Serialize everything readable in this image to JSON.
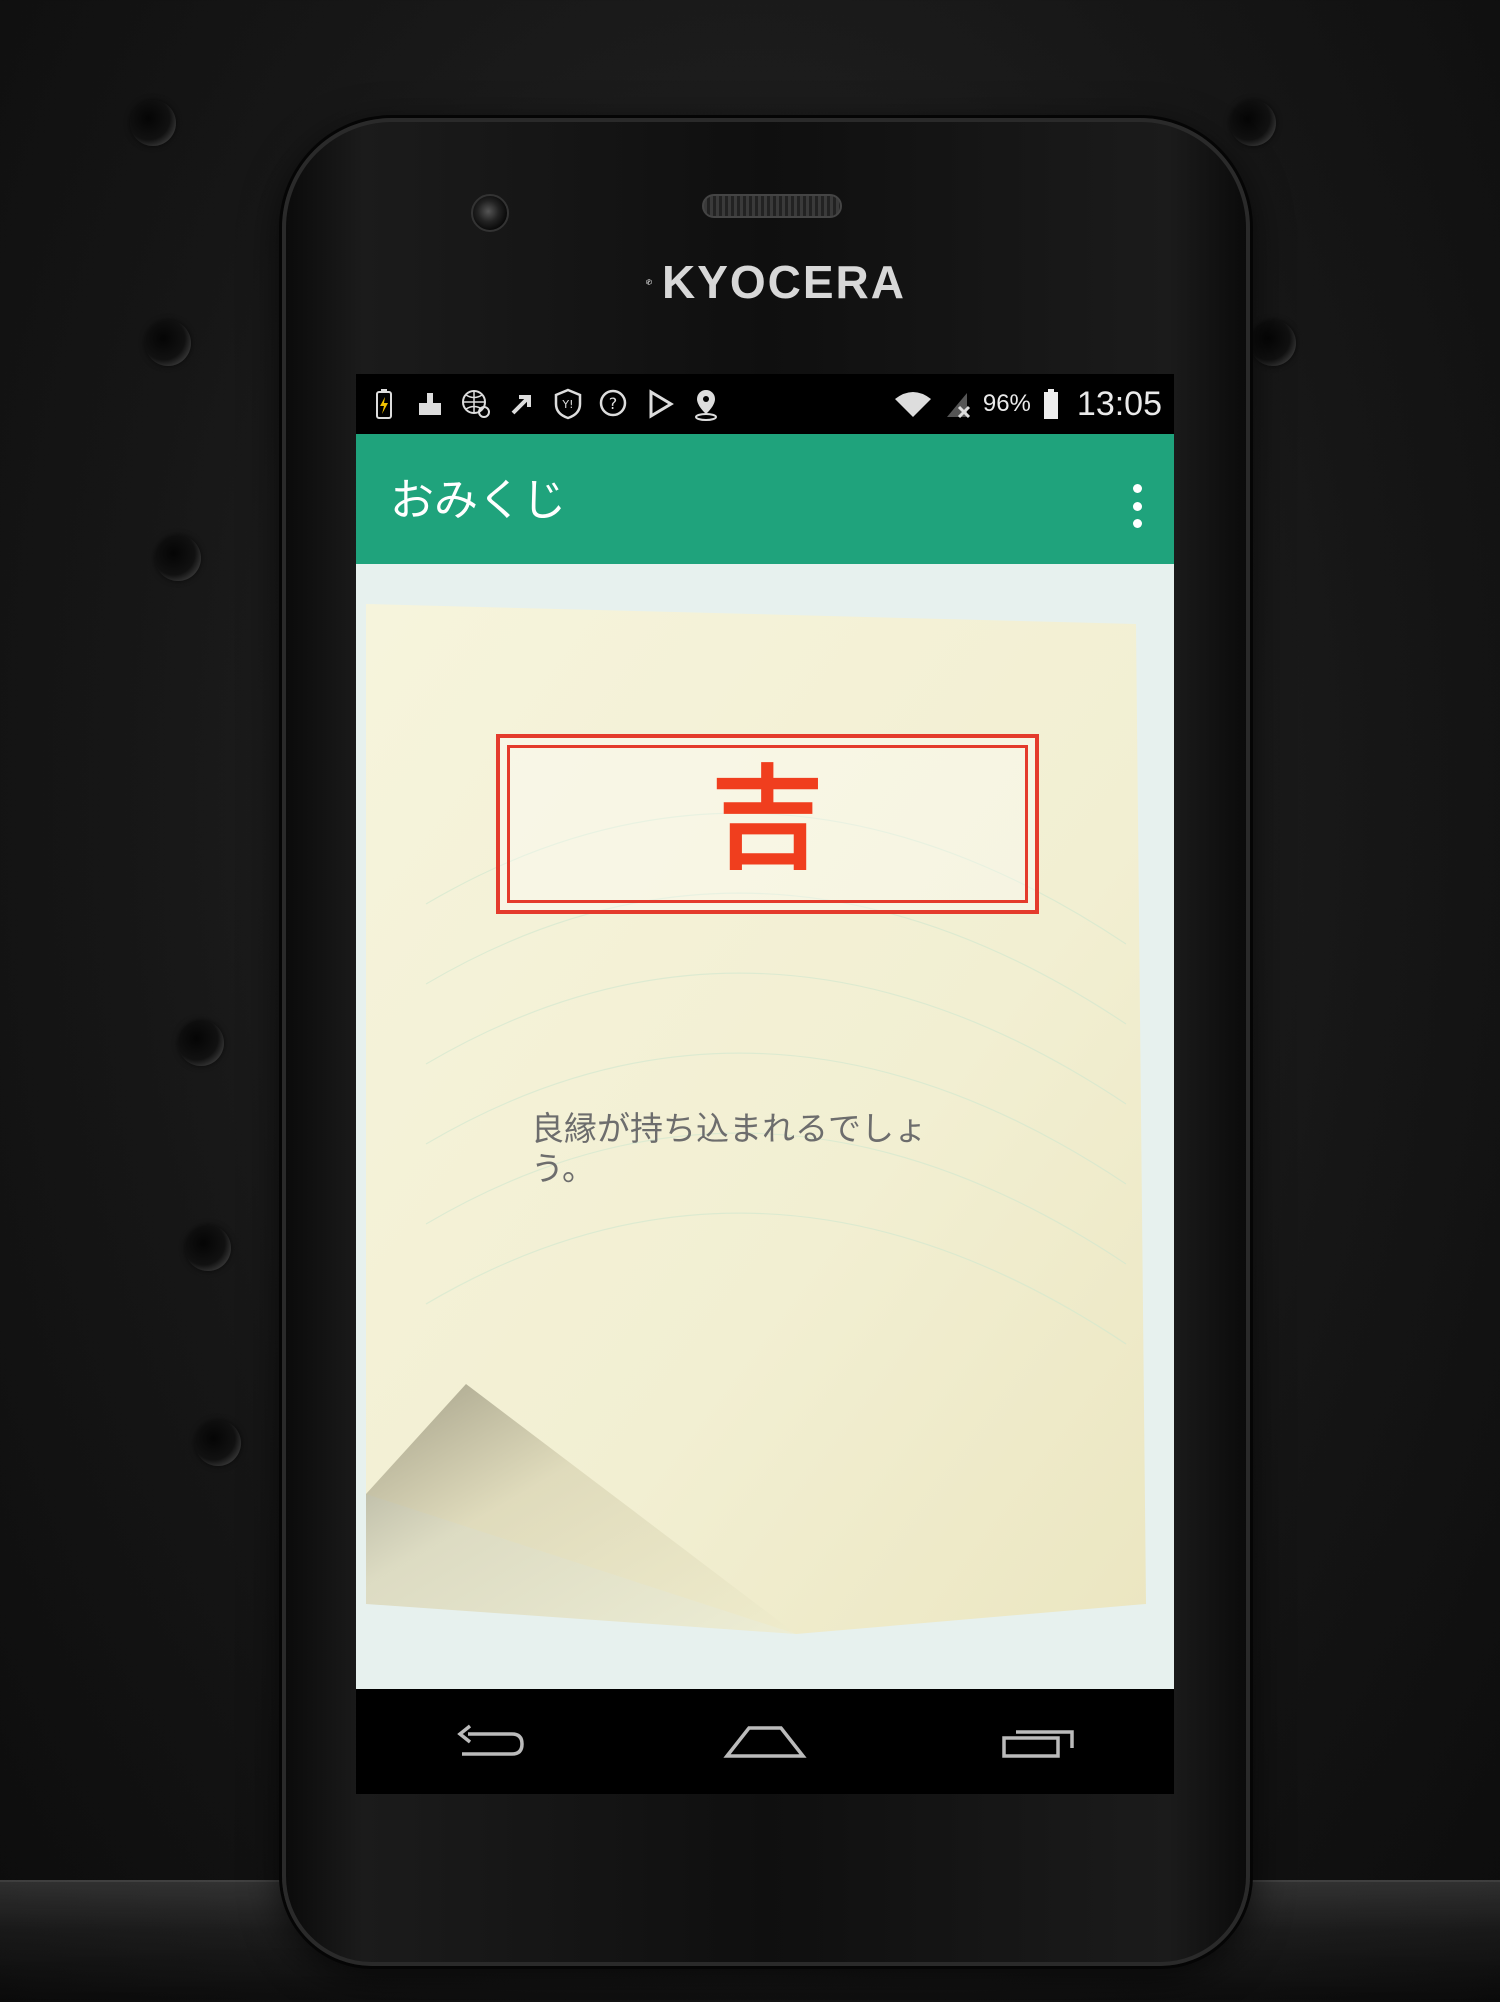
{
  "device": {
    "brand": "KYOCERA"
  },
  "status_bar": {
    "left_icons": [
      "battery-charging-icon",
      "cleaner-icon",
      "globe-search-icon",
      "arrow-up-right-icon",
      "yahoo-shield-icon",
      "help-icon",
      "play-store-icon",
      "map-pin-icon"
    ],
    "battery_percent": "96%",
    "time": "13:05"
  },
  "app_bar": {
    "title": "おみくじ",
    "overflow_icon": "more-vert-icon"
  },
  "omikuji": {
    "result": "吉",
    "message": "良縁が持ち込まれるでしょう。"
  },
  "colors": {
    "app_bar": "#1fa37c",
    "result_red": "#f03e1e",
    "frame_red": "#e43b2c",
    "paper": "#f3f1d8"
  },
  "nav_bar": {
    "icons": [
      "back-icon",
      "home-icon",
      "recents-icon"
    ]
  }
}
